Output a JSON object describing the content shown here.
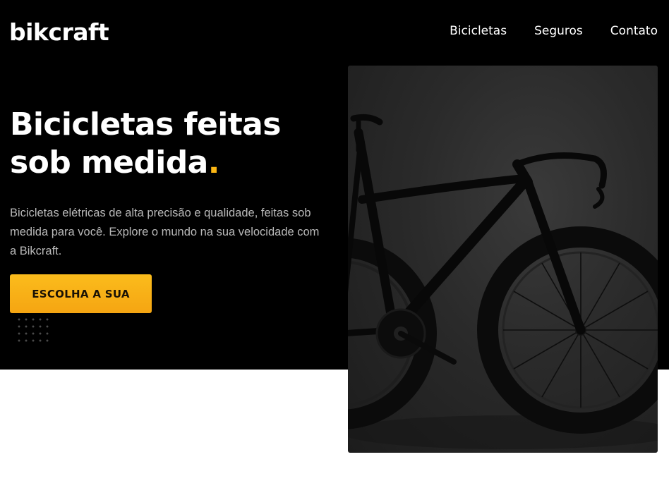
{
  "brand": {
    "logo": "bikcraft",
    "accent_color": "#fbb614"
  },
  "nav": {
    "items": [
      "Bicicletas",
      "Seguros",
      "Contato"
    ]
  },
  "hero": {
    "headline_line1": "Bicicletas feitas",
    "headline_line2": "sob medida",
    "headline_dot": ".",
    "description": "Bicicletas elétricas de alta precisão e qualidade, feitas sob medida para você. Explore o mundo na sua velocidade com a Bikcraft.",
    "cta_label": "ESCOLHA A SUA"
  }
}
